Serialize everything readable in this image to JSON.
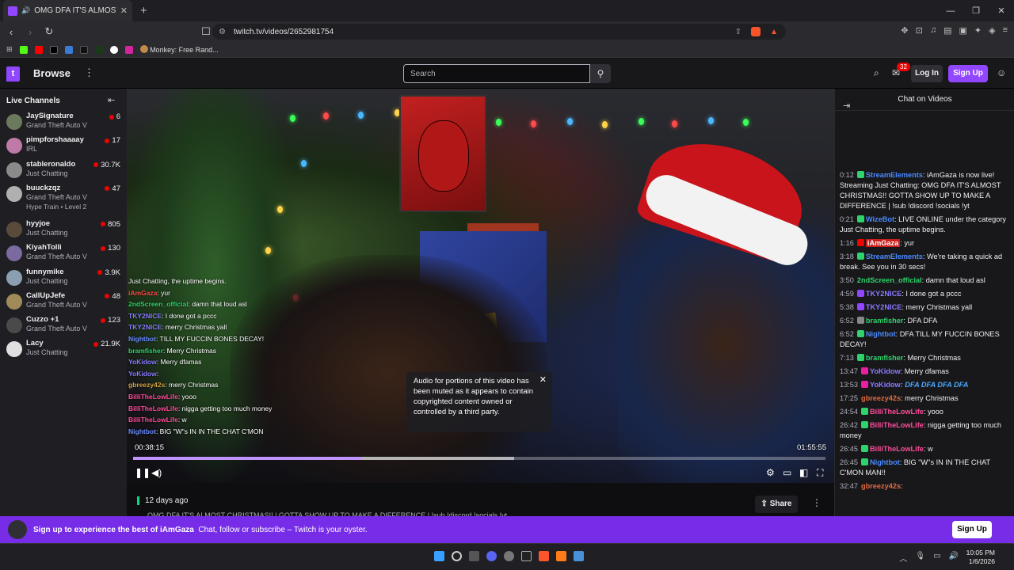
{
  "browser": {
    "tab_title": "OMG DFA IT'S ALMOST CH",
    "url": "twitch.tv/videos/2652981754",
    "bookmark_label": "Monkey: Free Rand...",
    "new_tab": "+",
    "tab_close": "✕"
  },
  "nav": {
    "browse": "Browse",
    "search_placeholder": "Search",
    "notif_count": "32",
    "login": "Log In",
    "signup": "Sign Up"
  },
  "sidebar": {
    "title": "Live Channels",
    "channels": [
      {
        "name": "JaySignature",
        "game": "Grand Theft Auto V",
        "viewers": "6",
        "color": "#6b7a5c"
      },
      {
        "name": "pimpforshaaaay",
        "game": "IRL",
        "viewers": "17",
        "color": "#c07aa8"
      },
      {
        "name": "stableronaldo",
        "game": "Just Chatting",
        "viewers": "30.7K",
        "color": "#8a8a8a"
      },
      {
        "name": "buuckzqz",
        "game": "Grand Theft Auto V",
        "viewers": "47",
        "extra": "Hype Train • Level 2",
        "color": "#b0b0b0"
      },
      {
        "name": "hyyjoe",
        "game": "Just Chatting",
        "viewers": "805",
        "color": "#5a4a3a"
      },
      {
        "name": "KiyahTolli",
        "game": "Grand Theft Auto V",
        "viewers": "130",
        "color": "#7a6aa0"
      },
      {
        "name": "funnymike",
        "game": "Just Chatting",
        "viewers": "3.9K",
        "color": "#8aa0b0"
      },
      {
        "name": "CallUpJefe",
        "game": "Grand Theft Auto V",
        "viewers": "48",
        "color": "#a08a5a"
      },
      {
        "name": "Cuzzo +1",
        "game": "Grand Theft Auto V",
        "viewers": "123",
        "color": "#4a4a4a"
      },
      {
        "name": "Lacy",
        "game": "Just Chatting",
        "viewers": "21.9K",
        "color": "#e0e0e0"
      }
    ]
  },
  "video": {
    "mute_notice": "Audio for portions of this video has been muted as it appears to contain copyrighted content owned or controlled by a third party.",
    "time_current": "00:38:15",
    "time_total": "01:55:55",
    "progress": 0.33,
    "buffered_end": 0.55,
    "overlay_chat": [
      {
        "user": "",
        "text": "Just Chatting, the uptime begins.",
        "color": "#ffffff"
      },
      {
        "user": "iAmGaza",
        "text": ": yur",
        "color": "#ff4a4a"
      },
      {
        "user": "2ndScreen_official",
        "text": ": damn that loud asl",
        "color": "#2fd36b"
      },
      {
        "user": "TKY2NICE",
        "text": ": I done got a pccc",
        "color": "#8a7aff"
      },
      {
        "user": "TKY2NICE",
        "text": ": merry Christmas yall",
        "color": "#8a7aff"
      },
      {
        "user": "",
        "text": "",
        "color": "#ffffff"
      },
      {
        "user": "Nightbot",
        "text": ": TILL MY FUCCIN BONES DECAY!",
        "color": "#6a8aff"
      },
      {
        "user": "bramfisher",
        "text": ": Merry Christmas",
        "color": "#2fd36b"
      },
      {
        "user": "YoKidow",
        "text": ": Merry dfamas",
        "color": "#8a7aff"
      },
      {
        "user": "YoKidow",
        "text": ":",
        "color": "#8a7aff"
      },
      {
        "user": "gbreezy42s",
        "text": ": merry Christmas",
        "color": "#d0a040"
      },
      {
        "user": "BilliTheLowLife",
        "text": ": yooo",
        "color": "#ff4a9a"
      },
      {
        "user": "BilliTheLowLife",
        "text": ": nigga getting too much money",
        "color": "#ff4a9a"
      },
      {
        "user": "BilliTheLowLife",
        "text": ": w",
        "color": "#ff4a9a"
      },
      {
        "user": "Nightbot",
        "text": ": BIG \"W\"s IN IN THE CHAT C'MON",
        "color": "#6a8aff"
      }
    ]
  },
  "below": {
    "ago": "12 days ago",
    "share": "Share",
    "title": "OMG DFA IT'S ALMOST CHRISTMAS!! | GOTTA SHOW UP TO MAKE A DIFFERENCE | !sub !discord !socials !yt"
  },
  "chat": {
    "title": "Chat on Videos",
    "messages": [
      {
        "time": "0:12",
        "user": "StreamElements",
        "text": ": iAmGaza is now live! Streaming Just Chatting: OMG DFA IT'S ALMOST CHRISTMAS!! GOTTA SHOW UP TO MAKE A DIFFERENCE | !sub !discord !socials !yt",
        "color": "#4a8aff",
        "badge": "#2fd36b"
      },
      {
        "time": "0:21",
        "user": "WizeBot",
        "text": ": LIVE ONLINE under the category Just Chatting, the uptime begins.",
        "color": "#4a8aff",
        "badge": "#2fd36b"
      },
      {
        "time": "1:16",
        "user": "iAmGaza",
        "text": ": yur",
        "color": "#ffffff",
        "badge": "#eb0400",
        "userbg": "#c81e1e"
      },
      {
        "time": "3:18",
        "user": "StreamElements",
        "text": ": We're taking a quick ad break. See you in 30 secs!",
        "color": "#4a8aff",
        "badge": "#2fd36b"
      },
      {
        "time": "3:50",
        "user": "2ndScreen_official",
        "text": ": damn that loud asl",
        "color": "#2fd36b",
        "badge": ""
      },
      {
        "time": "4:59",
        "user": "TKY2NICE",
        "text": ": I done got a pccc",
        "color": "#8a7aff",
        "badge": "#9147ff"
      },
      {
        "time": "5:38",
        "user": "TKY2NICE",
        "text": ": merry Christmas yall",
        "color": "#8a7aff",
        "badge": "#9147ff"
      },
      {
        "time": "6:52",
        "user": "bramfisher",
        "text": ": DFA DFA",
        "color": "#2fd36b",
        "badge": "#888888"
      },
      {
        "time": "6:52",
        "user": "Nightbot",
        "text": ": DFA TILL MY FUCCIN BONES DECAY!",
        "color": "#4a8aff",
        "badge": "#2fd36b"
      },
      {
        "time": "7:13",
        "user": "bramfisher",
        "text": ": Merry Christmas",
        "color": "#2fd36b",
        "badge": "#2fd36b"
      },
      {
        "time": "13:47",
        "user": "YoKidow",
        "text": ": Merry dfamas",
        "color": "#8a7aff",
        "badge": "#e91ea0"
      },
      {
        "time": "13:53",
        "user": "YoKidow",
        "text": ": DFA DFA DFA DFA",
        "color": "#8a7aff",
        "badge": "#e91ea0",
        "textcolor": "#4aa8ff"
      },
      {
        "time": "17:25",
        "user": "gbreezy42s",
        "text": ": merry Christmas",
        "color": "#e06a40",
        "badge": ""
      },
      {
        "time": "24:54",
        "user": "BilliTheLowLife",
        "text": ": yooo",
        "color": "#ff4a9a",
        "badge": "#2fd36b"
      },
      {
        "time": "26:42",
        "user": "BilliTheLowLife",
        "text": ": nigga getting too much money",
        "color": "#ff4a9a",
        "badge": "#2fd36b"
      },
      {
        "time": "26:45",
        "user": "BilliTheLowLife",
        "text": ": w",
        "color": "#ff4a9a",
        "badge": "#2fd36b"
      },
      {
        "time": "26:45",
        "user": "Nightbot",
        "text": ": BIG \"W\"s IN IN THE CHAT C'MON MAN!!",
        "color": "#4a8aff",
        "badge": "#2fd36b"
      },
      {
        "time": "32:47",
        "user": "gbreezy42s",
        "text": ":",
        "color": "#e06a40",
        "badge": ""
      }
    ]
  },
  "banner": {
    "lead": "Sign up to experience the best of iAmGaza",
    "sub": "Chat, follow or subscribe – Twitch is your oyster.",
    "signup": "Sign Up"
  },
  "taskbar": {
    "time": "10:05 PM",
    "date": "1/6/2026"
  }
}
